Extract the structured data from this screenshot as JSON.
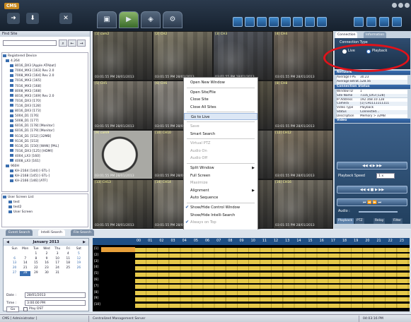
{
  "app": {
    "logo": "CMS",
    "window_controls": [
      "minimize",
      "maximize",
      "close"
    ]
  },
  "toolbar": {
    "main_tabs": [
      "live-tab",
      "playback-tab",
      "map-tab",
      "setup-tab"
    ],
    "layout_buttons": 10
  },
  "left": {
    "find_title": "Find Site",
    "find_placeholder": "",
    "tree_title": "Registered Device",
    "tree": [
      "Registered Device",
      "4.264",
      "8016_DX3 [Apple ATAbat]",
      "7004_MX3 [163] Rev 2.0",
      "7008_MX3 [164] Rev 2.0",
      "7016_MX3 [165]",
      "7016_MX3 [168]",
      "8008_MX3 [168]",
      "8016_MX3 [169] Rev 2.0",
      "7016_DX3 [170]",
      "7116_DX3 [128]",
      "8016_DX3 [173]",
      "5004_D1 [176]",
      "5008_D1 [177]",
      "6016_D1 [178] [Monitor]",
      "6016_D1 [179] [Monitor]",
      "9116_D1 [152] [32MB]",
      "9116_D1 [153]",
      "9116_D1 [150] [WAN] [PAL]",
      "7016_DX3 [125] [HDMI]",
      "4004_LX3 [160]",
      "4008_LX3 [161]",
      "960H",
      "KH-2164 [144] [-STL-]",
      "KH-2168 [145] [-STL-]",
      "KH-2166 [146] [ATF]"
    ],
    "user_screen": [
      "User Screen List",
      "test",
      "test2",
      "User Screen"
    ]
  },
  "grid": {
    "cells": [
      {
        "label": "[1] cam2",
        "ts": "03:01:55 PM 28/01/2013"
      },
      {
        "label": "[2] CH2",
        "ts": "03:01:55 PM 28/01/2013"
      },
      {
        "label": "[3] CH3",
        "ts": "03:01:55 PM 28/01/2013"
      },
      {
        "label": "[4] CH4",
        "ts": "03:01:55 PM 28/01/2013"
      },
      {
        "label": "[5] CH5",
        "ts": "03:01:55 PM 28/01/2013"
      },
      {
        "label": "[6] CH6",
        "ts": "03:01:55 PM 28/01/2013"
      },
      {
        "label": "[7] CH7",
        "ts": "03:01:55 PM 28/01/2013"
      },
      {
        "label": "[8] CH8",
        "ts": "03:01:55 PM 28/01/2013"
      },
      {
        "label": "[9] cam9",
        "ts": "03:01:55 PM 28/01/2013"
      },
      {
        "label": "[10] CH10",
        "ts": "03:01:55 PM 28/01/2013"
      },
      {
        "label": "[11] CH11",
        "ts": "03:01:55 PM 28/01/2013"
      },
      {
        "label": "[12] CH12",
        "ts": "03:01:55 PM 28/01/2013"
      },
      {
        "label": "[13] CH13",
        "ts": "03:01:55 PM 28/01/2013"
      },
      {
        "label": "[14] CH14",
        "ts": "03:01:55 PM 28/01/2013"
      },
      {
        "label": "[15] CH15",
        "ts": "03:01:55 PM 28/01/2013"
      },
      {
        "label": "[16] CH16",
        "ts": "03:01:55 PM 28/01/2013"
      }
    ]
  },
  "context_menu": [
    "Open New Window",
    "Open Site/File",
    "Close Site",
    "Close All Sites",
    "Go to Live",
    "Save",
    "Smart Search",
    "Virtual PTZ",
    "Audio On",
    "Audio Off",
    "Split Window",
    "Full Screen",
    "Maximize",
    "Alignment",
    "Auto Sequence",
    "Show/Hide Control Window",
    "Show/Hide Intelli-Search",
    "Always on Top"
  ],
  "right": {
    "tabs": [
      "Connection",
      "Information"
    ],
    "connection_type_label": "Connection Type",
    "radio_live": "Live",
    "radio_playback": "Playback",
    "network_title": "Network",
    "network": [
      [
        "Average FPS",
        "30.23"
      ],
      [
        "Average Bitrat...",
        "528.56"
      ]
    ],
    "status_title": "Connection Status",
    "status": [
      [
        "Window ID",
        "1"
      ],
      [
        "Site Name",
        "7116_DX3 [128]"
      ],
      [
        "IP Address",
        "192.168.10.128"
      ],
      [
        "Camera",
        "[1] CH1111111111"
      ],
      [
        "Video Type",
        "Playback"
      ],
      [
        "Status",
        "Connected..."
      ],
      [
        "Description",
        "Memory > 32MB"
      ]
    ],
    "video_title": "Video",
    "playback_speed_label": "Playback Speed",
    "playback_speed_value": "1 x",
    "audio_label": "Audio :",
    "bottom_tabs": [
      "Playback",
      "PTZ",
      "Relay",
      "Filter"
    ]
  },
  "bottom": {
    "tabs": [
      "Event Search",
      "Intelli Search",
      "File Search"
    ],
    "calendar": {
      "month": "January 2013",
      "weekdays": [
        "Sun",
        "Mon",
        "Tue",
        "Wed",
        "Thu",
        "Fri",
        "Sat"
      ],
      "weeks": [
        [
          "",
          "",
          "1",
          "2",
          "3",
          "4",
          "5"
        ],
        [
          "6",
          "7",
          "8",
          "9",
          "10",
          "11",
          "12"
        ],
        [
          "13",
          "14",
          "15",
          "16",
          "17",
          "18",
          "19"
        ],
        [
          "20",
          "21",
          "22",
          "23",
          "24",
          "25",
          "26"
        ],
        [
          "27",
          "28",
          "29",
          "30",
          "31",
          "",
          ""
        ]
      ],
      "selected": "28"
    },
    "date_label": "Date :",
    "date_value": "28/01/2013",
    "time_label": "Time :",
    "time_value": "3:00:00 PM",
    "go_label": "Go",
    "play_dst_label": "Play DST",
    "hours": [
      "00",
      "01",
      "02",
      "03",
      "04",
      "05",
      "06",
      "07",
      "08",
      "09",
      "10",
      "11",
      "12",
      "13",
      "14",
      "15",
      "16",
      "17",
      "18",
      "19",
      "20",
      "21",
      "22",
      "23"
    ],
    "channels": [
      "[1]",
      "[2]",
      "[3]",
      "[4]",
      "[5]",
      "[6]",
      "[7]",
      "[8]",
      "[9]",
      "[10]"
    ]
  },
  "status": {
    "user": "CMS [ Administrator ]",
    "title": "Centralized Management Server",
    "time": "04:03:16 PM"
  }
}
